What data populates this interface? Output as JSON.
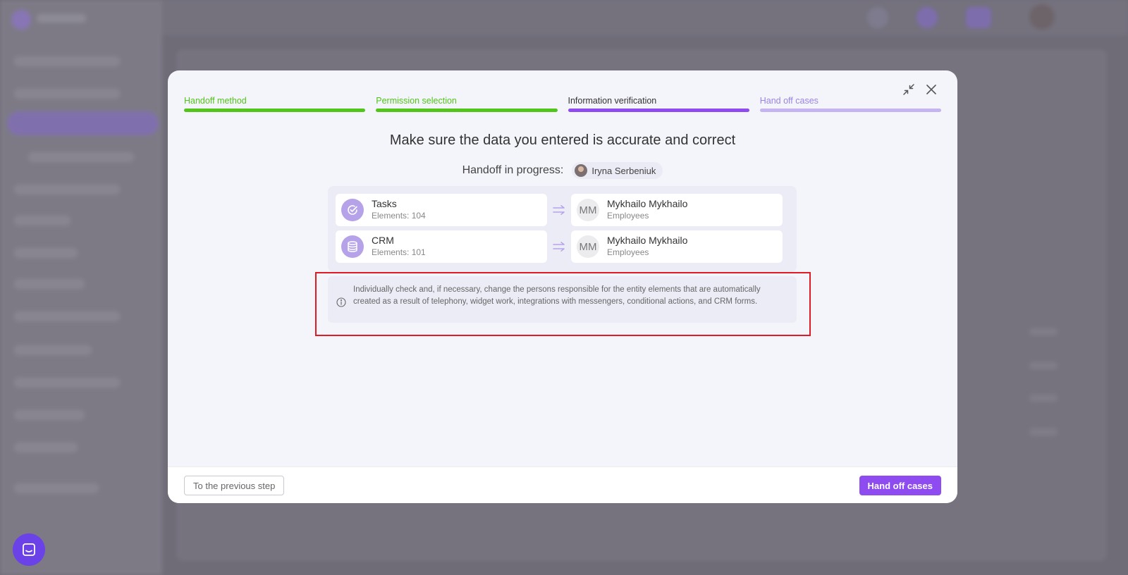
{
  "steps": [
    {
      "label": "Handoff method",
      "state": "done"
    },
    {
      "label": "Permission selection",
      "state": "done"
    },
    {
      "label": "Information verification",
      "state": "current"
    },
    {
      "label": "Hand off cases",
      "state": "todo"
    }
  ],
  "heading": "Make sure the data you entered is accurate and correct",
  "handoff": {
    "label": "Handoff in progress:",
    "user_name": "Iryna Serbeniuk"
  },
  "mappings": [
    {
      "entity": "Tasks",
      "elements": "Elements: 104",
      "icon": "check-circle-icon",
      "assignee_initials": "MM",
      "assignee_name": "Mykhailo Mykhailo",
      "assignee_role": "Employees"
    },
    {
      "entity": "CRM",
      "elements": "Elements: 101",
      "icon": "database-icon",
      "assignee_initials": "MM",
      "assignee_name": "Mykhailo Mykhailo",
      "assignee_role": "Employees"
    }
  ],
  "notice": "Individually check and, if necessary, change the persons responsible for the entity elements that are automatically created as a result of telephony, widget work, integrations with messengers, conditional actions, and CRM forms.",
  "footer": {
    "prev_label": "To the previous step",
    "primary_label": "Hand off cases"
  },
  "colors": {
    "accent": "#8d4bf0",
    "done": "#52c41a",
    "highlight": "#e01b24"
  }
}
